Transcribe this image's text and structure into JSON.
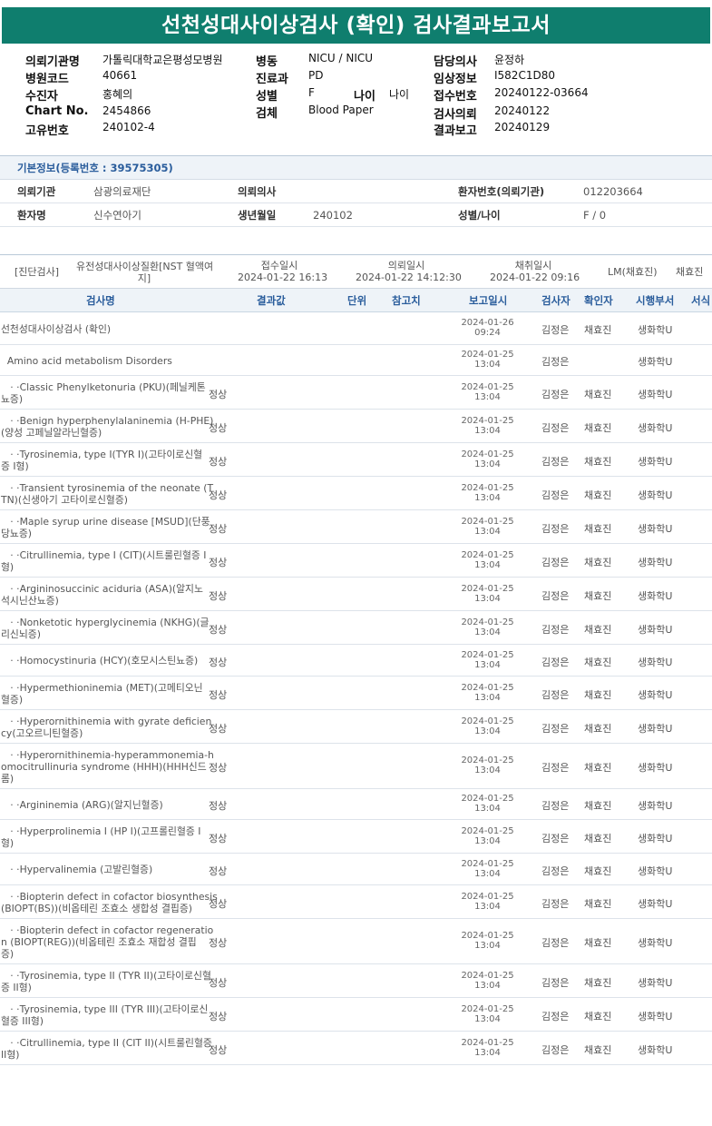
{
  "report_title": "선천성대사이상검사 (확인) 검사결과보고서",
  "header": {
    "col1": [
      {
        "label": "의뢰기관명",
        "value": "가톨릭대학교은평성모병원"
      },
      {
        "label": "병원코드",
        "value": "40661"
      },
      {
        "label": "수진자",
        "value": "홍혜의"
      },
      {
        "label": "Chart No.",
        "value": "2454866"
      },
      {
        "label": "고유번호",
        "value": "240102-4"
      }
    ],
    "col2": [
      {
        "label": "병동",
        "value": "NICU / NICU"
      },
      {
        "label": "진료과",
        "value": "PD"
      },
      {
        "label": "성별",
        "value": "F"
      },
      {
        "label": "검체",
        "value": "Blood Paper"
      }
    ],
    "age_label": "나이",
    "age_value": "나이",
    "col3": [
      {
        "label": "담당의사",
        "value": "윤정하"
      },
      {
        "label": "임상정보",
        "value": "I582C1D80"
      },
      {
        "label": "접수번호",
        "value": "20240122-03664"
      },
      {
        "label": "검사의뢰",
        "value": "20240122"
      },
      {
        "label": "결과보고",
        "value": "20240129"
      }
    ]
  },
  "basic_info": {
    "title": "기본정보(등록번호 : 39575305)",
    "institution_label": "의뢰기관",
    "institution": "삼광의료재단",
    "doctor_label": "의뢰의사",
    "doctor": "",
    "patient_no_label": "환자번호(의뢰기관)",
    "patient_no": "012203664",
    "patient_name_label": "환자명",
    "patient_name": "신수연아기",
    "dob_label": "생년월일",
    "dob": "240102",
    "sex_age_label": "성별/나이",
    "sex_age": "F / 0"
  },
  "test_info": {
    "category": "[진단검사]",
    "test_name_l1": "유전성대사이상질환[NST 혈액여",
    "test_name_l2": "지]",
    "received_label": "접수일시",
    "received": "2024-01-22 16:13",
    "requested_label": "의뢰일시",
    "requested": "2024-01-22 14:12:30",
    "collected_label": "채취일시",
    "collected": "2024-01-22 09:16",
    "lm": "LM(채효진)",
    "collector": "채효진"
  },
  "columns": {
    "name": "검사명",
    "result": "결과값",
    "unit": "단위",
    "ref": "참고치",
    "report_date": "보고일시",
    "tester": "검사자",
    "verifier": "확인자",
    "dept": "시행부서",
    "form": "서식"
  },
  "rows": [
    {
      "name1": "선천성대사이상검사 (확인)",
      "name2": "",
      "result": "",
      "date": "2024-01-26",
      "time": "09:24",
      "tester": "김정은",
      "verifier": "채효진",
      "dept": "생화학U"
    },
    {
      "name1": "  Amino acid metabolism Disorders",
      "name2": "",
      "result": "",
      "date": "2024-01-25",
      "time": "13:04",
      "tester": "김정은",
      "verifier": "",
      "dept": "생화학U"
    },
    {
      "name1": "   · ·Classic Phenylketonuria (PKU)(페닐케톤",
      "name2": "뇨증)",
      "result": "정상",
      "date": "2024-01-25",
      "time": "13:04",
      "tester": "김정은",
      "verifier": "채효진",
      "dept": "생화학U"
    },
    {
      "name1": "   · ·Benign hyperphenylalaninemia (H-PHE)",
      "name2": "(양성 고페닐알라닌혈증)",
      "result": "정상",
      "date": "2024-01-25",
      "time": "13:04",
      "tester": "김정은",
      "verifier": "채효진",
      "dept": "생화학U"
    },
    {
      "name1": "   · ·Tyrosinemia, type Ⅰ(TYR I)(고타이로신혈",
      "name2": "증 I형)",
      "result": "정상",
      "date": "2024-01-25",
      "time": "13:04",
      "tester": "김정은",
      "verifier": "채효진",
      "dept": "생화학U"
    },
    {
      "name1": "   · ·Transient tyrosinemia of the neonate (T",
      "name2": "TN)(신생아기 고타이로신혈증)",
      "result": "정상",
      "date": "2024-01-25",
      "time": "13:04",
      "tester": "김정은",
      "verifier": "채효진",
      "dept": "생화학U"
    },
    {
      "name1": "   · ·Maple syrup urine disease [MSUD](단풍",
      "name2": "당뇨증)",
      "result": "정상",
      "date": "2024-01-25",
      "time": "13:04",
      "tester": "김정은",
      "verifier": "채효진",
      "dept": "생화학U"
    },
    {
      "name1": "   · ·Citrullinemia, type I (CIT)(시트룰린혈증 I",
      "name2": "형)",
      "result": "정상",
      "date": "2024-01-25",
      "time": "13:04",
      "tester": "김정은",
      "verifier": "채효진",
      "dept": "생화학U"
    },
    {
      "name1": "   · ·Argininosuccinic aciduria (ASA)(알지노",
      "name2": "석시닌산뇨증)",
      "result": "정상",
      "date": "2024-01-25",
      "time": "13:04",
      "tester": "김정은",
      "verifier": "채효진",
      "dept": "생화학U"
    },
    {
      "name1": "   · ·Nonketotic hyperglycinemia (NKHG)(글",
      "name2": "리신뇌증)",
      "result": "정상",
      "date": "2024-01-25",
      "time": "13:04",
      "tester": "김정은",
      "verifier": "채효진",
      "dept": "생화학U"
    },
    {
      "name1": "   · ·Homocystinuria (HCY)(호모시스틴뇨증)",
      "name2": "",
      "result": "정상",
      "date": "2024-01-25",
      "time": "13:04",
      "tester": "김정은",
      "verifier": "채효진",
      "dept": "생화학U"
    },
    {
      "name1": "   · ·Hypermethioninemia (MET)(고메티오닌",
      "name2": "혈증)",
      "result": "정상",
      "date": "2024-01-25",
      "time": "13:04",
      "tester": "김정은",
      "verifier": "채효진",
      "dept": "생화학U"
    },
    {
      "name1": "   · ·Hyperornithinemia with gyrate deficien",
      "name2": "cy(고오르니틴혈증)",
      "result": "정상",
      "date": "2024-01-25",
      "time": "13:04",
      "tester": "김정은",
      "verifier": "채효진",
      "dept": "생화학U"
    },
    {
      "name1": "   · ·Hyperornithinemia-hyperammonemia-h",
      "name2": "omocitrullinuria syndrome (HHH)(HHH신드",
      "name3": "롬)",
      "result": "정상",
      "date": "2024-01-25",
      "time": "13:04",
      "tester": "김정은",
      "verifier": "채효진",
      "dept": "생화학U"
    },
    {
      "name1": "   · ·Argininemia (ARG)(알지닌혈증)",
      "name2": "",
      "result": "정상",
      "date": "2024-01-25",
      "time": "13:04",
      "tester": "김정은",
      "verifier": "채효진",
      "dept": "생화학U"
    },
    {
      "name1": "   · ·Hyperprolinemia I (HP I)(고프롤린혈증 I",
      "name2": "형)",
      "result": "정상",
      "date": "2024-01-25",
      "time": "13:04",
      "tester": "김정은",
      "verifier": "채효진",
      "dept": "생화학U"
    },
    {
      "name1": "   · ·Hypervalinemia (고발린혈증)",
      "name2": "",
      "result": "정상",
      "date": "2024-01-25",
      "time": "13:04",
      "tester": "김정은",
      "verifier": "채효진",
      "dept": "생화학U"
    },
    {
      "name1": "   · ·Biopterin defect in cofactor biosynthesis",
      "name2": "(BIOPT(BS))(비옵테린 조효소 생합성 결핍증)",
      "result": "정상",
      "date": "2024-01-25",
      "time": "13:04",
      "tester": "김정은",
      "verifier": "채효진",
      "dept": "생화학U"
    },
    {
      "name1": "   · ·Biopterin defect in cofactor regeneratio",
      "name2": "n (BIOPT(REG))(비옵테린 조효소 재합성 결핍",
      "name3": "증)",
      "result": "정상",
      "date": "2024-01-25",
      "time": "13:04",
      "tester": "김정은",
      "verifier": "채효진",
      "dept": "생화학U"
    },
    {
      "name1": "   · ·Tyrosinemia, type II (TYR II)(고타이로신혈",
      "name2": "증 II형)",
      "result": "정상",
      "date": "2024-01-25",
      "time": "13:04",
      "tester": "김정은",
      "verifier": "채효진",
      "dept": "생화학U"
    },
    {
      "name1": "   · ·Tyrosinemia, type III (TYR III)(고타이로신",
      "name2": "혈증 III형)",
      "result": "정상",
      "date": "2024-01-25",
      "time": "13:04",
      "tester": "김정은",
      "verifier": "채효진",
      "dept": "생화학U"
    },
    {
      "name1": "   · ·Citrullinemia, type II (CIT II)(시트룰린혈증",
      "name2": "II형)",
      "result": "정상",
      "date": "2024-01-25",
      "time": "13:04",
      "tester": "김정은",
      "verifier": "채효진",
      "dept": "생화학U"
    }
  ]
}
